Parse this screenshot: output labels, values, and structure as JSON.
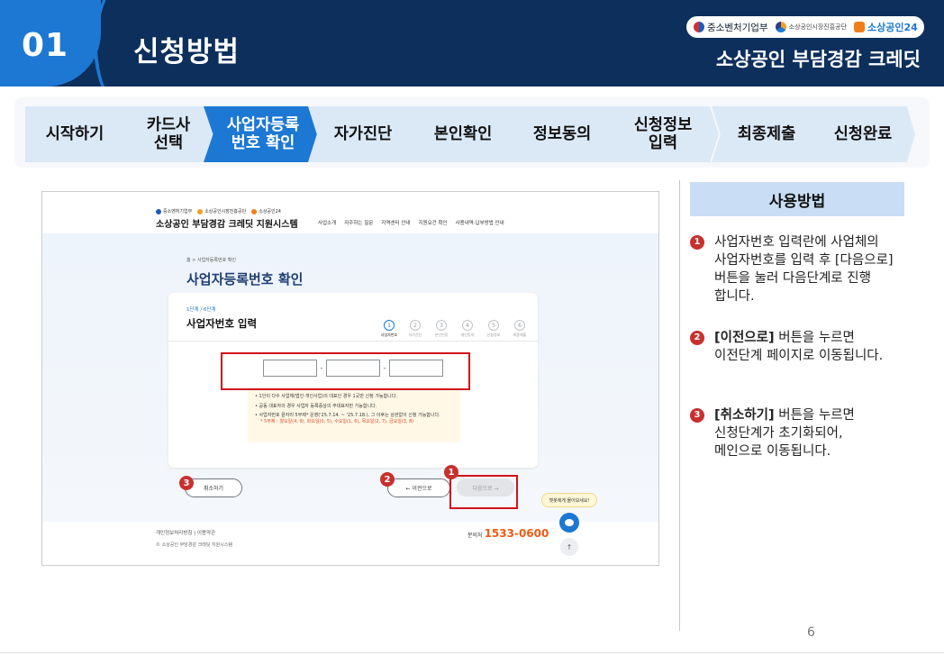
{
  "header": {
    "number": "01",
    "title": "신청방법",
    "subtitle": "소상공인 부담경감 크레딧",
    "logos": [
      "중소벤처기업부",
      "소상공인시장진흥공단",
      "소상공인24"
    ]
  },
  "steps": [
    {
      "label": "시작하기",
      "active": false
    },
    {
      "label": "카드사\n선택",
      "active": false
    },
    {
      "label": "사업자등록\n번호 확인",
      "active": true
    },
    {
      "label": "자가진단",
      "active": false
    },
    {
      "label": "본인확인",
      "active": false
    },
    {
      "label": "정보동의",
      "active": false
    },
    {
      "label": "신청정보\n입력",
      "active": false
    },
    {
      "label": "최종제출",
      "active": false
    },
    {
      "label": "신청완료",
      "active": false
    }
  ],
  "screenshot": {
    "logos": [
      "중소벤처기업부",
      "소상공인시장진흥공단",
      "소상공인24"
    ],
    "site_title": "소상공인 부담경감 크레딧 지원시스템",
    "menu": [
      "사업소개",
      "자주하는 질문",
      "지역센터 안내",
      "지원요건 확인",
      "사용내역·납부방법 안내"
    ],
    "breadcrumb": "홈 > 사업자등록번호 확인",
    "page_title": "사업자등록번호 확인",
    "card_step": "1단계 / 6단계",
    "card_title": "사업자번호 입력",
    "progress": [
      {
        "num": "1",
        "label": "사업자번호"
      },
      {
        "num": "2",
        "label": "자가진단"
      },
      {
        "num": "3",
        "label": "본인인증"
      },
      {
        "num": "4",
        "label": "개인동의"
      },
      {
        "num": "5",
        "label": "신청정보"
      },
      {
        "num": "6",
        "label": "최종제출"
      }
    ],
    "separator": "-",
    "notices": [
      "• 1인이 다수 사업체(법인·개인사업)의 대표인 경우 1곳만 신청 가능합니다.",
      "• 공동 대표자의 경우 사업자 등록증상의 주대표자만 가능합니다.",
      "• 사업자번호 끝자리 5부제* 운영('25.7.14. ~ '25.7.18.), 그 이후는 상관없이 신청 가능합니다.",
      "* 5부제 : 월요일(4, 9), 화요일(0, 5), 수요일(1, 6), 목요일(2, 7), 금요일(3, 8)"
    ],
    "cancel_label": "취소하기",
    "prev_label": "← 이전으로",
    "next_label": "다음으로 →",
    "chat_label": "챗봇에게 물어보세요!",
    "top_label": "↑",
    "footer_links": "개인정보처리방침 | 이용약관",
    "footer_copy": "© 소상공인 부담경감 크레딧 지원시스템",
    "phone_label": "문의처",
    "phone": "1533-0600",
    "badges": [
      "1",
      "2",
      "3"
    ]
  },
  "how_to": {
    "title": "사용방법",
    "items": [
      {
        "num": "1",
        "bold": "",
        "text": "사업자번호 입력란에 사업체의\n사업자번호를 입력 후 [다음으로]\n버튼을 눌러 다음단계로 진행\n합니다."
      },
      {
        "num": "2",
        "bold": "[이전으로]",
        "text": " 버튼을 누르면\n이전단계 페이지로 이동됩니다."
      },
      {
        "num": "3",
        "bold": "[취소하기]",
        "text": " 버튼을 누르면\n신청단계가 초기화되어,\n메인으로 이동됩니다."
      }
    ]
  },
  "page_number": "6",
  "colors": {
    "header_bg": "#0d2f5c",
    "accent": "#1c78d3",
    "step_bg": "#dbe9f7",
    "highlight_red": "#d2121a",
    "badge_red": "#c8302e",
    "phone_orange": "#f05a14"
  }
}
